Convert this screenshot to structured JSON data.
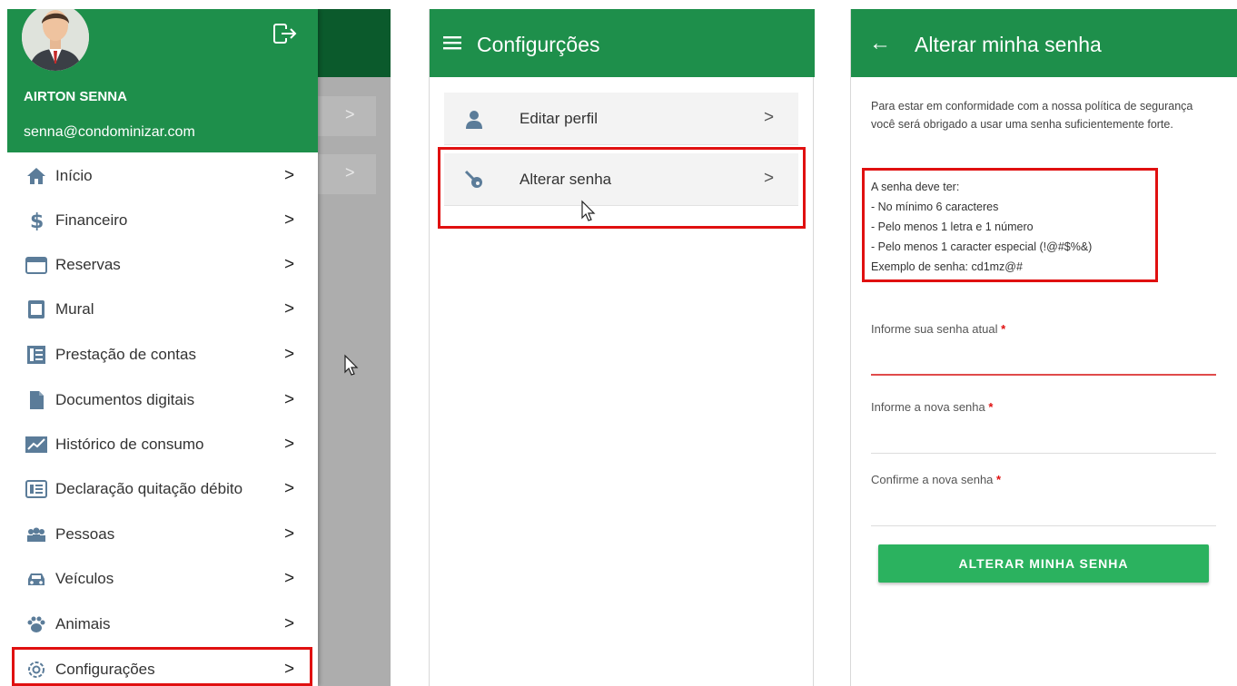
{
  "colors": {
    "header_green": "#1e8f4b",
    "button_green": "#2bb25f",
    "highlight_red": "#e01010",
    "required_red": "#e01010"
  },
  "drawer": {
    "user_name": "AIRTON SENNA",
    "user_email": "senna@condominizar.com",
    "items": [
      {
        "label": "Início",
        "icon": "home-icon"
      },
      {
        "label": "Financeiro",
        "icon": "dollar-icon"
      },
      {
        "label": "Reservas",
        "icon": "calendar-icon"
      },
      {
        "label": "Mural",
        "icon": "board-icon"
      },
      {
        "label": "Prestação de contas",
        "icon": "report-icon"
      },
      {
        "label": "Documentos digitais",
        "icon": "document-icon"
      },
      {
        "label": "Histórico de consumo",
        "icon": "chart-icon"
      },
      {
        "label": "Declaração quitação débito",
        "icon": "declaration-icon"
      },
      {
        "label": "Pessoas",
        "icon": "people-icon"
      },
      {
        "label": "Veículos",
        "icon": "car-icon"
      },
      {
        "label": "Animais",
        "icon": "paw-icon"
      },
      {
        "label": "Configurações",
        "icon": "gear-icon"
      }
    ],
    "chevron": ">"
  },
  "settings": {
    "title": "Configurções",
    "items": [
      {
        "label": "Editar perfil",
        "icon": "user-icon"
      },
      {
        "label": "Alterar senha",
        "icon": "key-icon"
      }
    ],
    "chevron": ">"
  },
  "change_password": {
    "title": "Alterar minha senha",
    "back_glyph": "←",
    "intro": "Para estar em conformidade com a nossa política de segurança você será obrigado a usar uma senha suficientemente forte.",
    "rules": [
      "A senha deve ter:",
      "- No mínimo 6 caracteres",
      "- Pelo menos 1 letra e 1 número",
      "- Pelo menos 1 caracter especial (!@#$%&)",
      "Exemplo de senha: cd1mz@#"
    ],
    "fields": [
      {
        "label": "Informe sua senha atual",
        "required": "*",
        "value": ""
      },
      {
        "label": "Informe a nova senha",
        "required": "*",
        "value": ""
      },
      {
        "label": "Confirme a nova senha",
        "required": "*",
        "value": ""
      }
    ],
    "submit_label": "ALTERAR MINHA SENHA"
  }
}
